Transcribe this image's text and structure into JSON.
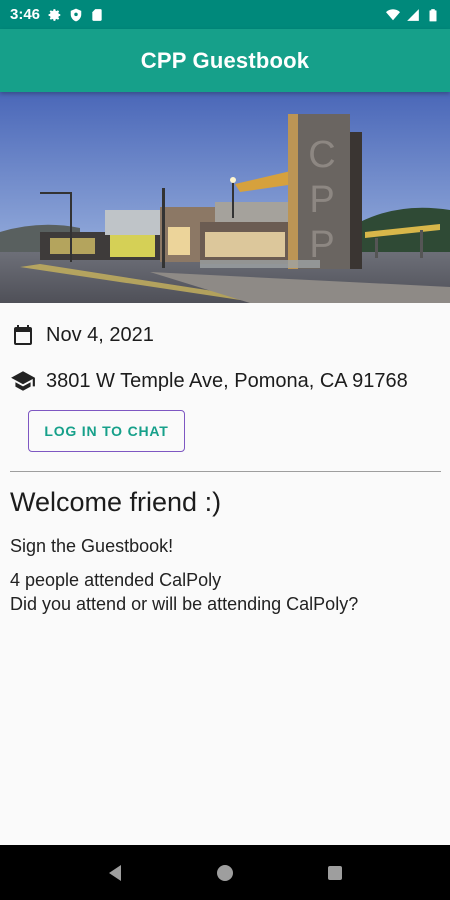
{
  "status_bar": {
    "time": "3:46",
    "icons_left": [
      "gear-icon",
      "shield-icon",
      "sd-card-icon"
    ],
    "icons_right": [
      "wifi-icon",
      "signal-icon",
      "battery-icon"
    ]
  },
  "app_bar": {
    "title": "CPP Guestbook"
  },
  "hero": {
    "sign_text": "CPP"
  },
  "event": {
    "date": "Nov 4, 2021",
    "date_icon": "calendar-icon",
    "location": "3801 W Temple Ave, Pomona, CA 91768",
    "location_icon": "school-icon"
  },
  "actions": {
    "login_label": "LOG IN TO CHAT"
  },
  "content": {
    "welcome": "Welcome friend :)",
    "sign_prompt": "Sign the Guestbook!",
    "attended_count": "4 people attended CalPoly",
    "attend_question": "Did you attend or will be attending CalPoly?"
  },
  "nav_bar": {
    "buttons": [
      "back-icon",
      "home-icon",
      "recents-icon"
    ]
  },
  "colors": {
    "status_bar": "#00897b",
    "app_bar": "#16a08a",
    "accent": "#16a08a",
    "button_outline": "#7e57c2"
  }
}
